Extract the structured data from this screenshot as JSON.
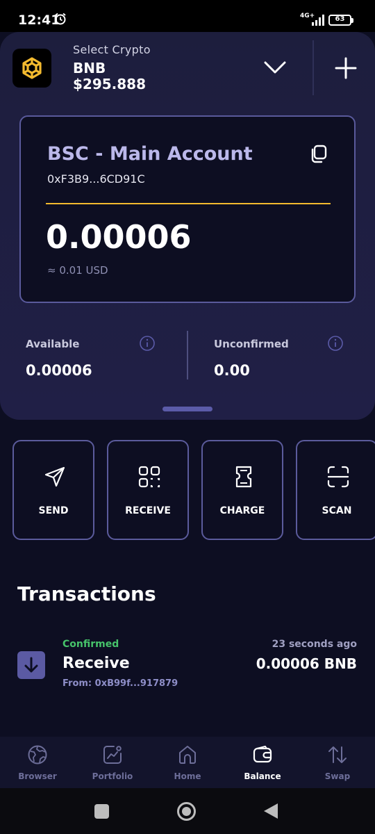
{
  "status_bar": {
    "time": "12:41",
    "network": "4G+",
    "battery": "63"
  },
  "header": {
    "select_label": "Select Crypto",
    "symbol": "BNB",
    "price": "$295.888",
    "logo_icon": "bnb-logo-icon",
    "dropdown_icon": "chevron-down-icon",
    "add_icon": "plus-icon"
  },
  "account": {
    "title": "BSC - Main Account",
    "address": "0xF3B9...6CD91C",
    "balance": "0.00006",
    "usd_value": "≈ 0.01 USD",
    "accent_color": "#f3ba2f"
  },
  "stats": {
    "available_label": "Available",
    "available_value": "0.00006",
    "unconfirmed_label": "Unconfirmed",
    "unconfirmed_value": "0.00"
  },
  "actions": [
    {
      "label": "SEND",
      "icon": "send-icon"
    },
    {
      "label": "RECEIVE",
      "icon": "qr-code-icon"
    },
    {
      "label": "CHARGE",
      "icon": "receipt-icon"
    },
    {
      "label": "SCAN",
      "icon": "scan-icon"
    }
  ],
  "transactions": {
    "heading": "Transactions",
    "items": [
      {
        "status": "Confirmed",
        "type": "Receive",
        "from": "From: 0xB99f...917879",
        "time": "23 seconds ago",
        "amount": "0.00006 BNB",
        "status_color": "#46c36a"
      }
    ]
  },
  "bottom_nav": {
    "active": "Balance",
    "items": [
      {
        "label": "Browser",
        "icon": "globe-icon"
      },
      {
        "label": "Portfolio",
        "icon": "chart-icon"
      },
      {
        "label": "Home",
        "icon": "home-icon"
      },
      {
        "label": "Balance",
        "icon": "wallet-icon"
      },
      {
        "label": "Swap",
        "icon": "swap-icon"
      }
    ]
  }
}
